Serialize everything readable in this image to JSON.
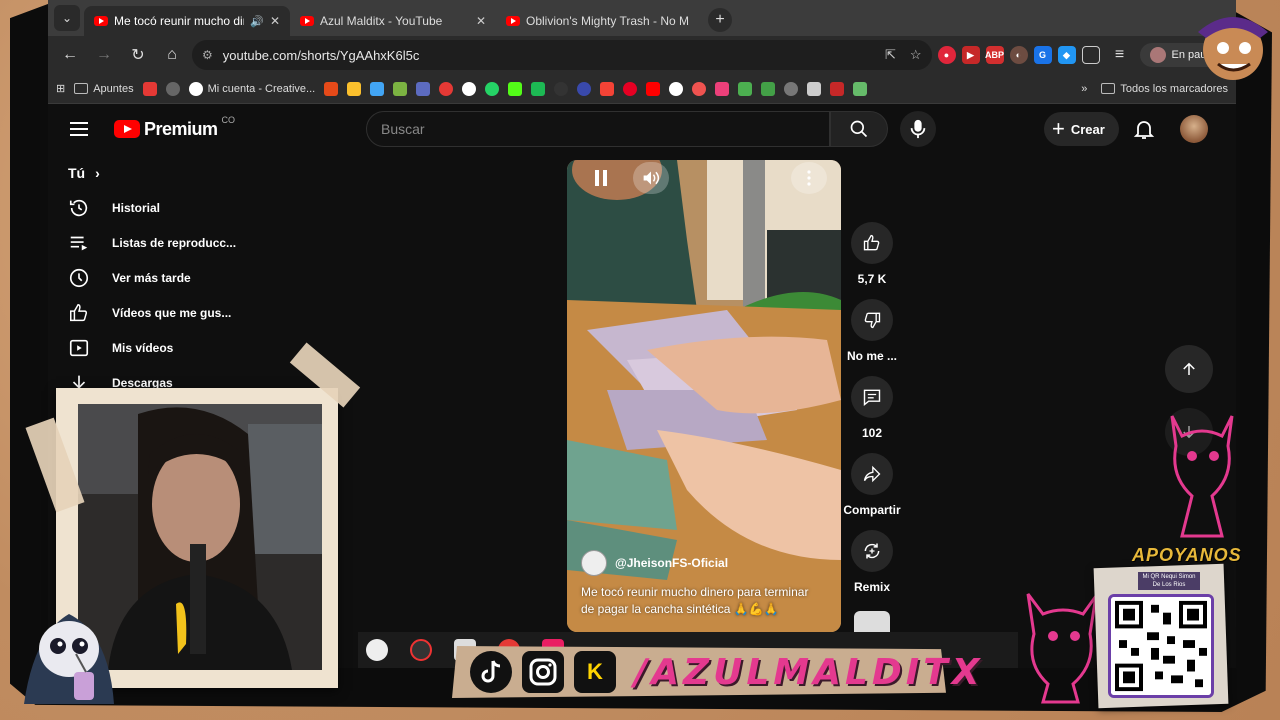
{
  "tabs": [
    {
      "title": "Me tocó reunir mucho dine",
      "active": true
    },
    {
      "title": "Azul Malditx - YouTube",
      "active": false
    },
    {
      "title": "Oblivion's Mighty Trash - No M",
      "active": false
    }
  ],
  "address": {
    "url": "youtube.com/shorts/YgAAhxK6l5c"
  },
  "profile": {
    "label": "En pausa"
  },
  "bookmarks": {
    "items": [
      "Apuntes",
      "Mi cuenta - Creative..."
    ],
    "all_label": "Todos los marcadores"
  },
  "youtube": {
    "logo_text": "Premium",
    "logo_sup": "CO",
    "search_placeholder": "Buscar",
    "create_label": "Crear"
  },
  "sidebar": {
    "section": "Tú",
    "items": [
      {
        "label": "Historial",
        "icon": "history-icon"
      },
      {
        "label": "Listas de reproducc...",
        "icon": "playlist-icon"
      },
      {
        "label": "Ver más tarde",
        "icon": "clock-icon"
      },
      {
        "label": "Vídeos que me gus...",
        "icon": "thumb-up-icon"
      },
      {
        "label": "Mis vídeos",
        "icon": "play-square-icon"
      },
      {
        "label": "Descargas",
        "icon": "download-icon"
      }
    ]
  },
  "short": {
    "channel": "@JheisonFS-Oficial",
    "caption": "Me tocó reunir mucho dinero para terminar de pagar la cancha sintética 🙏💪🙏"
  },
  "actions": {
    "like_count": "5,7 K",
    "dislike_label": "No me ...",
    "comments_count": "102",
    "share_label": "Compartir",
    "remix_label": "Remix"
  },
  "overlay": {
    "brand": "/AZULMALDITX",
    "support": "APOYANOS",
    "qr_label": "Mi QR Nequi Simon De Los Rios",
    "logo_letter": "K"
  },
  "colors": {
    "yt_red": "#ff0000",
    "accent_pink": "#e4398f",
    "support_gold": "#e8b93a"
  }
}
